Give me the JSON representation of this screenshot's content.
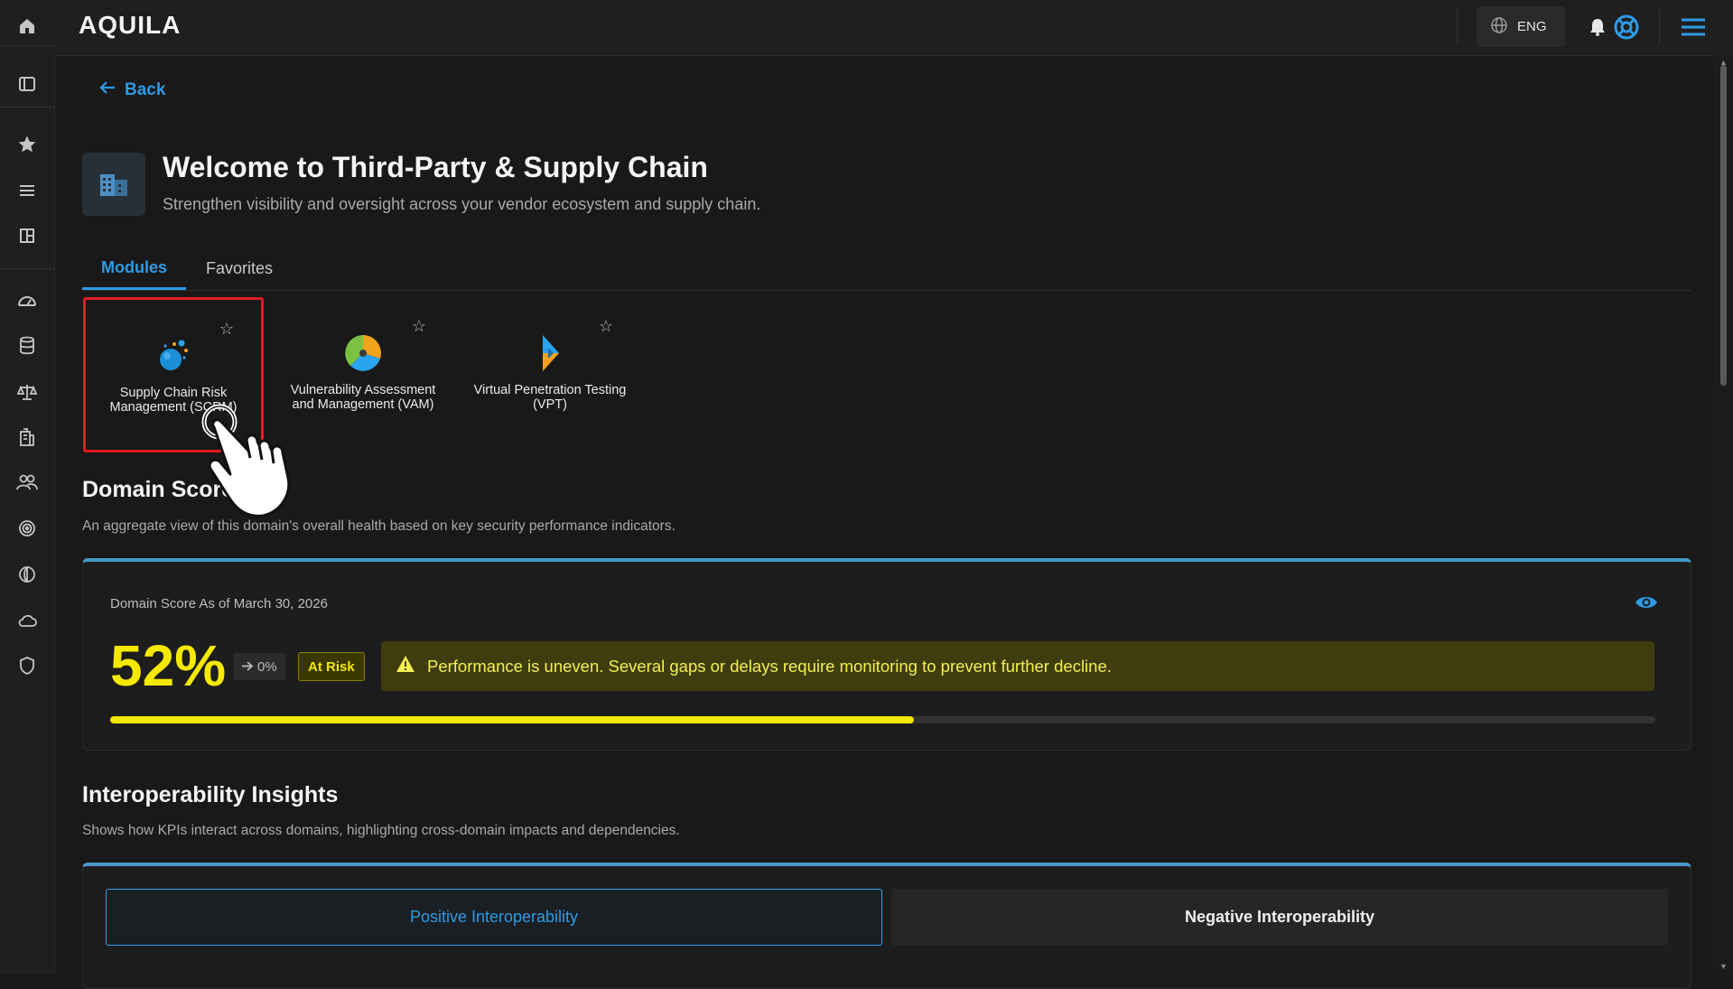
{
  "app": {
    "logo_text": "AQUILA"
  },
  "topbar": {
    "language": "ENG"
  },
  "nav": {
    "back_label": "Back"
  },
  "hero": {
    "title": "Welcome to Third-Party & Supply Chain",
    "subtitle": "Strengthen visibility and oversight across your vendor ecosystem and supply chain."
  },
  "tabs": [
    {
      "label": "Modules",
      "active": true
    },
    {
      "label": "Favorites",
      "active": false
    }
  ],
  "modules": [
    {
      "label": "Supply Chain Risk Management (SCRM)",
      "icon": "scrm-bubbles-icon",
      "selected": true
    },
    {
      "label": "Vulnerability Assessment and Management (VAM)",
      "icon": "vam-pie-icon",
      "selected": false
    },
    {
      "label": "Virtual Penetration Testing (VPT)",
      "icon": "vpt-arrow-icon",
      "selected": false
    }
  ],
  "domain_score": {
    "title": "Domain Score",
    "subtitle": "An aggregate view of this domain's overall health based on key security performance indicators.",
    "as_of": "Domain Score As of March 30, 2026",
    "value": "52%",
    "progress": 0.52,
    "delta": "0%",
    "status": "At Risk",
    "message": "Performance is uneven. Several gaps or delays require monitoring to prevent further decline.",
    "accent_color": "#f5e900"
  },
  "interoperability": {
    "title": "Interoperability Insights",
    "subtitle": "Shows how KPIs interact across domains, highlighting cross-domain impacts and dependencies.",
    "toggles": [
      {
        "label": "Positive Interoperability",
        "active": true
      },
      {
        "label": "Negative Interoperability",
        "active": false
      }
    ]
  },
  "colors": {
    "accent": "#2e9be6",
    "highlight": "#e31b23",
    "background": "#191919"
  }
}
